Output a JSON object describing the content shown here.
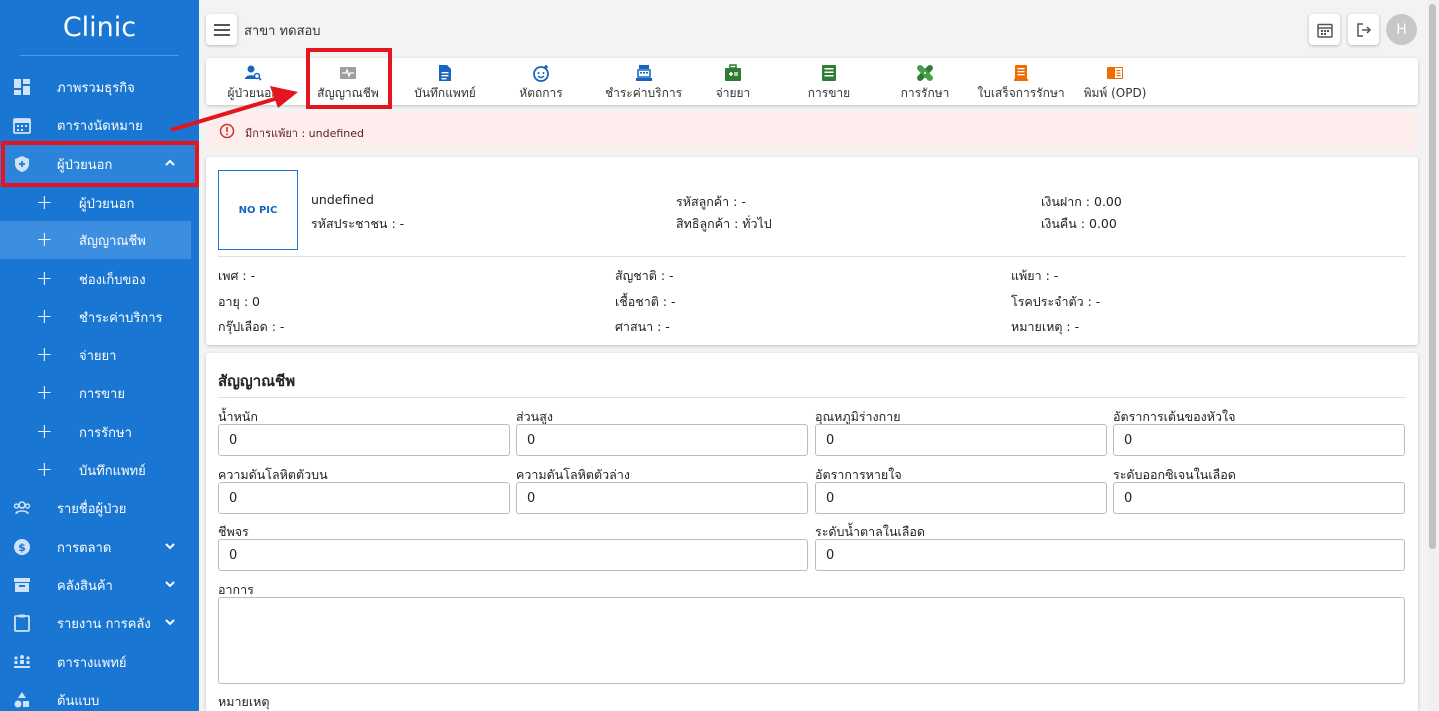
{
  "sidebar": {
    "brand": "Clinic",
    "items": [
      {
        "label": "ภาพรวมธุรกิจ",
        "icon": "dashboard-icon"
      },
      {
        "label": "ตารางนัดหมาย",
        "icon": "calendar-icon"
      },
      {
        "label": "ผู้ป่วยนอก",
        "icon": "shield-icon"
      },
      {
        "label": "รายชื่อผู้ป่วย",
        "icon": "patients-icon"
      },
      {
        "label": "การตลาด",
        "icon": "dollar-icon"
      },
      {
        "label": "คลังสินค้า",
        "icon": "archive-icon"
      },
      {
        "label": "รายงาน การคลัง",
        "icon": "clipboard-icon"
      },
      {
        "label": "ตารางแพทย์",
        "icon": "doctors-icon"
      },
      {
        "label": "ต้นแบบ",
        "icon": "shapes-icon"
      }
    ],
    "sub_items": [
      {
        "label": "ผู้ป่วยนอก"
      },
      {
        "label": "สัญญาณชีพ"
      },
      {
        "label": "ช่องเก็บของ"
      },
      {
        "label": "ชำระค่าบริการ"
      },
      {
        "label": "จ่ายยา"
      },
      {
        "label": "การขาย"
      },
      {
        "label": "การรักษา"
      },
      {
        "label": "บันทึกแพทย์"
      }
    ]
  },
  "header": {
    "branch": "สาขา ทดสอบ",
    "avatar": "H"
  },
  "toolbar": [
    {
      "label": "ผู้ป่วยนอก",
      "icon": "patient-search-icon",
      "color": "#1565c0"
    },
    {
      "label": "สัญญาณชีพ",
      "icon": "vital-signs-icon",
      "color": "#9e9e9e"
    },
    {
      "label": "บันทึกแพทย์",
      "icon": "document-icon",
      "color": "#1565c0"
    },
    {
      "label": "หัตถการ",
      "icon": "baby-face-icon",
      "color": "#1565c0"
    },
    {
      "label": "ชำระค่าบริการ",
      "icon": "cashier-icon",
      "color": "#1565c0"
    },
    {
      "label": "จ่ายยา",
      "icon": "medkit-icon",
      "color": "#2e7d32"
    },
    {
      "label": "การขาย",
      "icon": "list-icon",
      "color": "#2e7d32"
    },
    {
      "label": "การรักษา",
      "icon": "bandage-icon",
      "color": "#2e7d32"
    },
    {
      "label": "ใบเสร็จการรักษา",
      "icon": "receipt-icon",
      "color": "#ef6c00"
    },
    {
      "label": "พิมพ์ (OPD)",
      "icon": "print-icon",
      "color": "#ef6c00"
    }
  ],
  "alert": {
    "text": "มีการแพ้ยา : undefined"
  },
  "patient": {
    "nopic": "NO PIC",
    "name": "undefined",
    "citizen_id": "รหัสประชาชน : -",
    "customer_code": "รหัสลูกค้า : -",
    "customer_right": "สิทธิลูกค้า : ทั่วไป",
    "deposit": "เงินฝาก : 0.00",
    "refund": "เงินคืน : 0.00",
    "sex": "เพศ : -",
    "age": "อายุ : 0",
    "blood": "กรุ๊ปเลือด : -",
    "nationality": "สัญชาติ : -",
    "race": "เชื้อชาติ : -",
    "religion": "ศาสนา : -",
    "allergy": "แพ้ยา : -",
    "disease": "โรคประจำตัว : -",
    "note": "หมายเหตุ : -"
  },
  "vitals": {
    "title": "สัญญาณชีพ",
    "fields": [
      {
        "label": "น้ำหนัก",
        "value": "0"
      },
      {
        "label": "ส่วนสูง",
        "value": "0"
      },
      {
        "label": "อุณหภูมิร่างกาย",
        "value": "0"
      },
      {
        "label": "อัตราการเต้นของหัวใจ",
        "value": "0"
      },
      {
        "label": "ความดันโลหิตตัวบน",
        "value": "0"
      },
      {
        "label": "ความดันโลหิตตัวล่าง",
        "value": "0"
      },
      {
        "label": "อัตราการหายใจ",
        "value": "0"
      },
      {
        "label": "ระดับออกซิเจนในเลือด",
        "value": "0"
      },
      {
        "label": "ชีพจร",
        "value": "0"
      },
      {
        "label": "ระดับน้ำตาลในเลือด",
        "value": "0"
      }
    ],
    "symptom_label": "อาการ",
    "symptom_value": "",
    "note_label": "หมายเหตุ"
  }
}
